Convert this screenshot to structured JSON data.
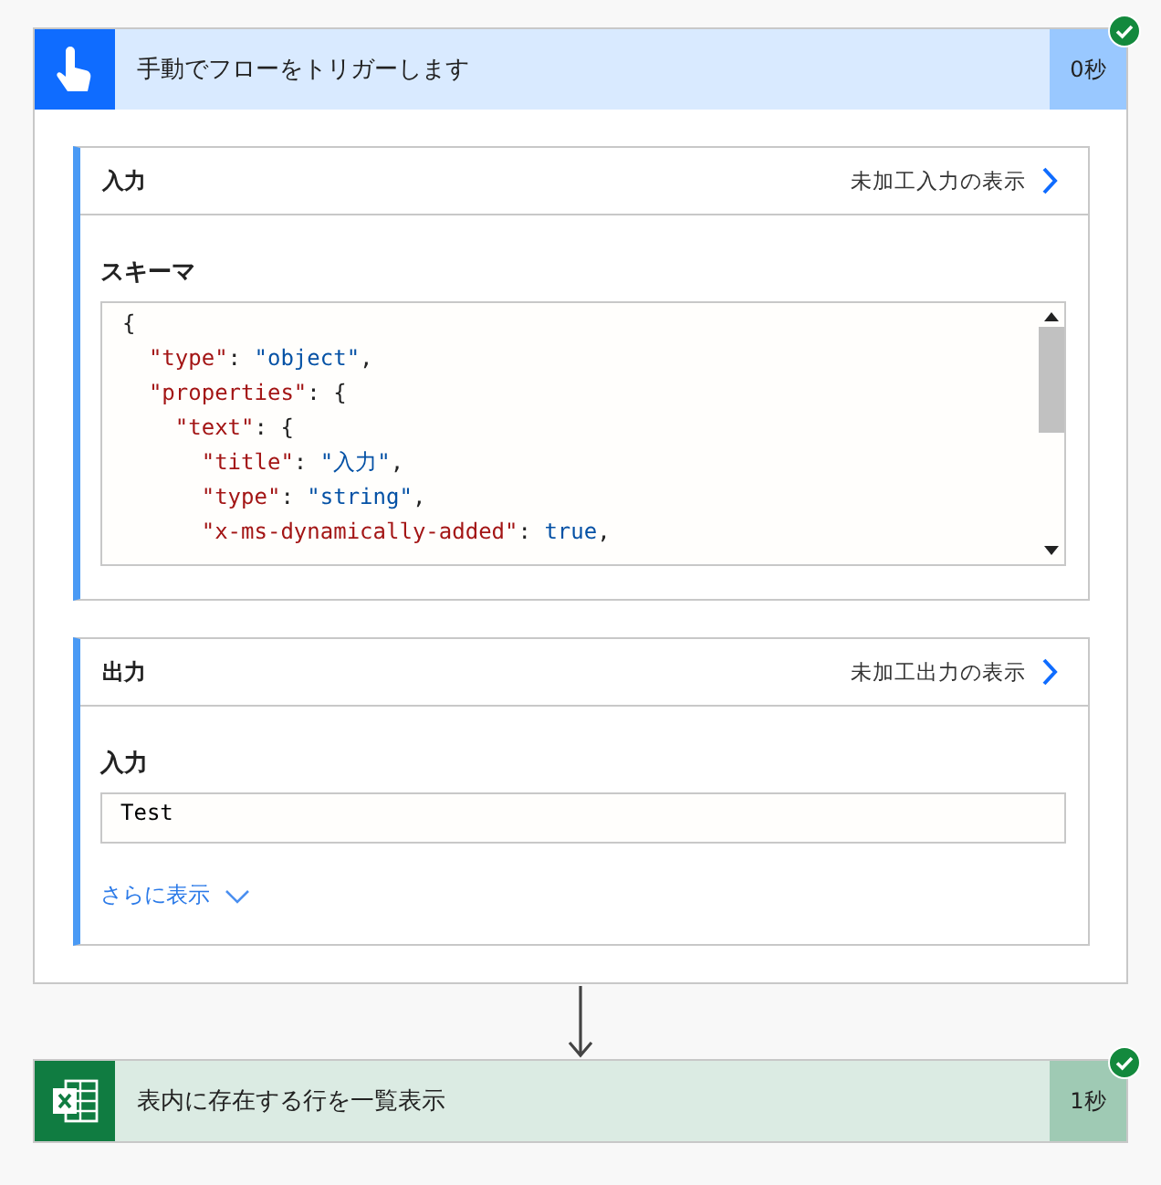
{
  "steps": [
    {
      "kind": "trigger",
      "title": "手動でフローをトリガーします",
      "duration": "0秒",
      "succeeded": true,
      "sections": [
        {
          "kind": "code",
          "title": "入力",
          "raw_link": "未加工入力の表示",
          "field_label": "スキーマ",
          "code_lines": [
            [
              {
                "kind": "punct",
                "text": "{"
              }
            ],
            [
              {
                "kind": "key",
                "text": "  \"type\""
              },
              {
                "kind": "punct",
                "text": ": "
              },
              {
                "kind": "string",
                "text": "\"object\""
              },
              {
                "kind": "punct",
                "text": ","
              }
            ],
            [
              {
                "kind": "key",
                "text": "  \"properties\""
              },
              {
                "kind": "punct",
                "text": ": {"
              }
            ],
            [
              {
                "kind": "key",
                "text": "    \"text\""
              },
              {
                "kind": "punct",
                "text": ": {"
              }
            ],
            [
              {
                "kind": "key",
                "text": "      \"title\""
              },
              {
                "kind": "punct",
                "text": ": "
              },
              {
                "kind": "string",
                "text": "\"入力\""
              },
              {
                "kind": "punct",
                "text": ","
              }
            ],
            [
              {
                "kind": "key",
                "text": "      \"type\""
              },
              {
                "kind": "punct",
                "text": ": "
              },
              {
                "kind": "string",
                "text": "\"string\""
              },
              {
                "kind": "punct",
                "text": ","
              }
            ],
            [
              {
                "kind": "key",
                "text": "      \"x-ms-dynamically-added\""
              },
              {
                "kind": "punct",
                "text": ": "
              },
              {
                "kind": "bool",
                "text": "true"
              },
              {
                "kind": "punct",
                "text": ","
              }
            ]
          ]
        },
        {
          "kind": "fields",
          "title": "出力",
          "raw_link": "未加工出力の表示",
          "field_label": "入力",
          "value": "Test",
          "more_link": "さらに表示"
        }
      ]
    },
    {
      "kind": "excel",
      "title": "表内に存在する行を一覧表示",
      "duration": "1秒",
      "succeeded": true
    }
  ]
}
